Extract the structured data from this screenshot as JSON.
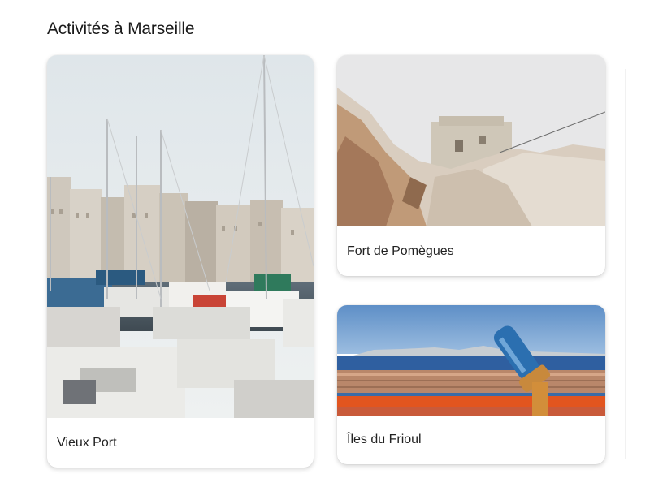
{
  "page": {
    "title": "Activités à Marseille"
  },
  "cards": [
    {
      "label": "Vieux Port",
      "image": "harbor-sailboats-photo"
    },
    {
      "label": "Fort de Pomègues",
      "image": "rocky-fort-photo"
    },
    {
      "label": "Îles du Frioul",
      "image": "sea-view-binoculars-photo"
    }
  ],
  "colors": {
    "text": "#1b1b1b",
    "card_bg": "#ffffff",
    "sea": "#2f5fa0",
    "railing": "#e2551f"
  }
}
